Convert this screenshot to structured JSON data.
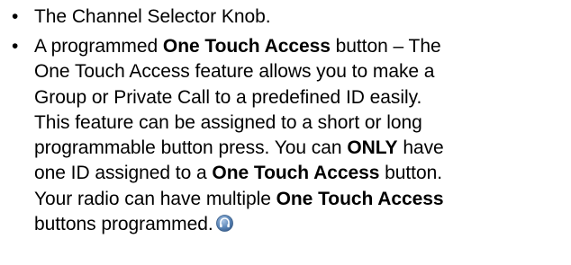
{
  "bullets": [
    {
      "mark": "•",
      "text": "The Channel Selector Knob."
    },
    {
      "mark": "•",
      "lines": [
        {
          "parts": [
            "A programmed ",
            "One Touch Access",
            " button – The"
          ]
        },
        {
          "parts": [
            "One Touch Access feature allows you to make a"
          ]
        },
        {
          "parts": [
            "Group or Private Call to a predefined ID easily."
          ]
        },
        {
          "parts": [
            "This feature can be assigned to a short or long"
          ]
        },
        {
          "parts": [
            "programmable button press. You can ",
            "ONLY",
            " have"
          ]
        },
        {
          "parts": [
            "one ID assigned to a ",
            "One Touch Access",
            " button."
          ]
        },
        {
          "parts": [
            "Your radio can have multiple ",
            "One Touch Access"
          ]
        },
        {
          "parts": [
            "buttons programmed."
          ]
        }
      ],
      "icon": "radio-feature-emblem-icon"
    }
  ],
  "colors": {
    "text": "#000000",
    "emblem": "#5b86b8"
  }
}
